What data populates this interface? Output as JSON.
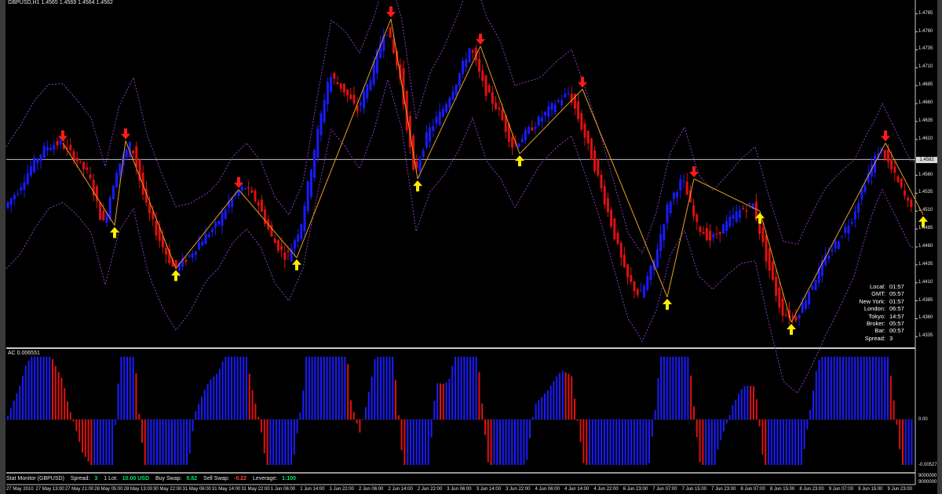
{
  "header": {
    "symbol_title": "GBPUSD,H1  1.4565 1.4569 1.4564 1.4562",
    "current_price_tag": "1.4582"
  },
  "indicator": {
    "title": "AC 0.006551",
    "axis_labels": [
      "0.00",
      "-0.00527"
    ],
    "extra_labels": [
      "9000000",
      "9000000"
    ]
  },
  "price_axis": {
    "ticks": [
      "1.4785",
      "1.4760",
      "1.4735",
      "1.4710",
      "1.4685",
      "1.4660",
      "1.4635",
      "1.4610",
      "1.4560",
      "1.4535",
      "1.4510",
      "1.4485",
      "1.4460",
      "1.4435",
      "1.4410",
      "1.4385",
      "1.4360",
      "1.4335"
    ]
  },
  "time_axis": {
    "ticks": [
      "27 May 2010",
      "27 May 13:00",
      "27 May 21:00",
      "28 May 05:00",
      "28 May 13:00",
      "30 May 22:00",
      "31 May 06:00",
      "31 May 14:00",
      "31 May 22:00",
      "1 Jun 06:00",
      "1 Jun 14:00",
      "1 Jun 22:00",
      "2 Jun 06:00",
      "2 Jun 14:00",
      "2 Jun 22:00",
      "3 Jun 06:00",
      "3 Jun 14:00",
      "3 Jun 22:00",
      "4 Jun 06:00",
      "4 Jun 14:00",
      "4 Jun 22:00",
      "6 Jun 23:00",
      "7 Jun 07:00",
      "7 Jun 15:00",
      "7 Jun 23:00",
      "8 Jun 07:00",
      "8 Jun 15:00",
      "8 Jun 23:00",
      "9 Jun 07:00",
      "9 Jun 15:00",
      "9 Jun 23:00"
    ]
  },
  "clock": {
    "rows": [
      {
        "label": "Local:",
        "value": "01:57"
      },
      {
        "label": "GMT:",
        "value": "05:57"
      },
      {
        "label": "New York:",
        "value": "01:57"
      },
      {
        "label": "London:",
        "value": "06:57"
      },
      {
        "label": "Tokyo:",
        "value": "14:57"
      },
      {
        "label": "Broker:",
        "value": "05:57"
      },
      {
        "label": "Bar:",
        "value": "00:57"
      },
      {
        "label": "Spread:",
        "value": "3"
      }
    ]
  },
  "status_bar": {
    "monitor_label": "Stat Monitor (GBPUSD)",
    "spread_label": "Spread:",
    "spread_value": "3",
    "lot_label": "1 Lot:",
    "lot_value": "10.00 USD",
    "buy_swap_label": "Buy Swap:",
    "buy_swap_value": "0.82",
    "sell_swap_label": "Sell Swap:",
    "sell_swap_value": "-0.22",
    "leverage_label": "Leverage:",
    "leverage_value": "1:100"
  },
  "colors": {
    "bull_candle": "#1a1aff",
    "bear_candle": "#e01010",
    "zigzag": "#e8a020",
    "bands": "#8a3cc8",
    "arrow_up": "#ffee00",
    "arrow_down": "#ff1a1a"
  },
  "chart_data": {
    "type": "line",
    "series": [
      {
        "x": [
          0,
          18,
          36,
          54,
          72,
          90,
          108,
          126,
          144,
          162,
          180,
          198,
          216,
          234,
          252,
          270,
          288,
          306,
          324,
          342,
          360,
          378,
          396,
          414,
          432,
          450,
          468,
          486,
          504,
          522,
          540,
          558,
          576,
          594,
          612,
          630,
          648,
          666,
          684,
          702,
          720,
          738,
          756,
          774,
          792,
          810,
          828,
          846,
          864,
          882,
          900,
          918,
          936,
          954,
          972,
          990,
          1008,
          1026,
          1044,
          1062,
          1080,
          1098,
          1116,
          1134,
          1152
        ],
        "values": [
          1.4515,
          1.454,
          1.4575,
          1.46,
          1.4605,
          1.4585,
          1.456,
          1.449,
          1.457,
          1.4605,
          1.452,
          1.447,
          1.443,
          1.4445,
          1.447,
          1.449,
          1.4525,
          1.4545,
          1.452,
          1.447,
          1.4445,
          1.449,
          1.46,
          1.47,
          1.468,
          1.465,
          1.47,
          1.477,
          1.47,
          1.456,
          1.462,
          1.465,
          1.469,
          1.474,
          1.468,
          1.465,
          1.46,
          1.462,
          1.464,
          1.466,
          1.4675,
          1.462,
          1.456,
          1.449,
          1.442,
          1.439,
          1.444,
          1.452,
          1.4555,
          1.449,
          1.447,
          1.449,
          1.451,
          1.452,
          1.444,
          1.437,
          1.436,
          1.44,
          1.444,
          1.447,
          1.45,
          1.4555,
          1.46,
          1.456,
          1.452
        ]
      }
    ],
    "zigzag_points": [
      {
        "x": 72,
        "y": 1.4605
      },
      {
        "x": 138,
        "y": 1.449
      },
      {
        "x": 152,
        "y": 1.4608
      },
      {
        "x": 216,
        "y": 1.443
      },
      {
        "x": 296,
        "y": 1.454
      },
      {
        "x": 370,
        "y": 1.4445
      },
      {
        "x": 490,
        "y": 1.4778
      },
      {
        "x": 524,
        "y": 1.4555
      },
      {
        "x": 604,
        "y": 1.474
      },
      {
        "x": 654,
        "y": 1.459
      },
      {
        "x": 734,
        "y": 1.468
      },
      {
        "x": 842,
        "y": 1.439
      },
      {
        "x": 876,
        "y": 1.4555
      },
      {
        "x": 960,
        "y": 1.451
      },
      {
        "x": 1000,
        "y": 1.4355
      },
      {
        "x": 1120,
        "y": 1.4605
      },
      {
        "x": 1168,
        "y": 1.4505
      }
    ],
    "horizontal_line": 1.4582,
    "ylim": [
      1.432,
      1.48
    ]
  }
}
